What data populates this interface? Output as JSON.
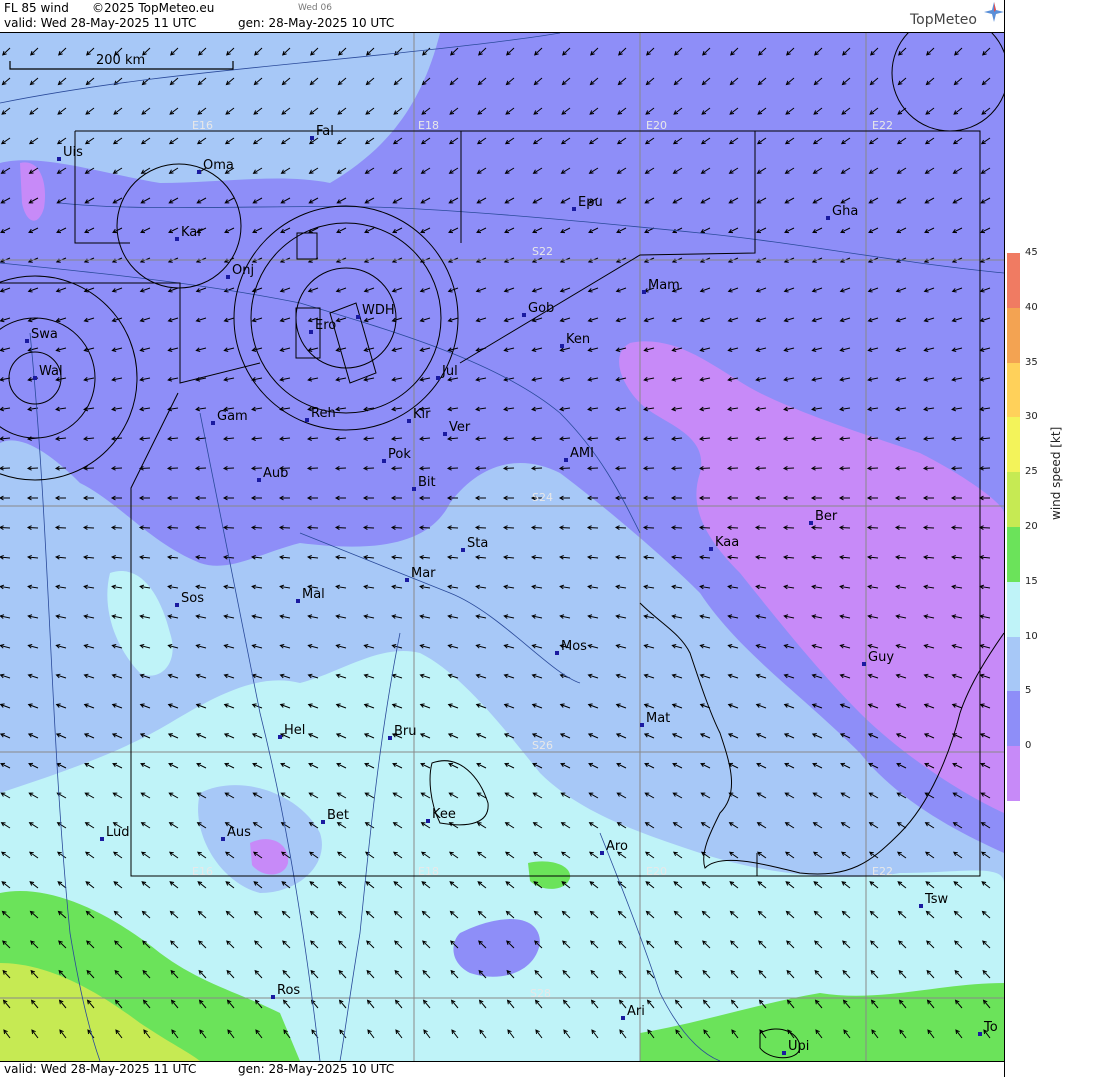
{
  "header": {
    "title": "FL 85 wind",
    "copyright": "©2025 TopMeteo.eu",
    "day": "Wed 06",
    "valid": "valid:  Wed  28-May-2025  11 UTC",
    "gen": "gen: 28-May-2025 10 UTC",
    "logo": "TopMeteo"
  },
  "footer": {
    "valid": "valid:  Wed  28-May-2025  11 UTC",
    "gen": "gen: 28-May-2025 10 UTC"
  },
  "scale_label": "200 km",
  "grid_labels": [
    "E16",
    "E18",
    "E20",
    "E22",
    "S22",
    "S24",
    "S26",
    "S28"
  ],
  "places": [
    "Uis",
    "Oma",
    "Fal",
    "Kar",
    "Onj",
    "Epu",
    "Gha",
    "Swa",
    "Wal",
    "Gob",
    "Mam",
    "Ken",
    "Ero",
    "WDH",
    "Jul",
    "Gam",
    "Reh",
    "Kir",
    "Ver",
    "Pok",
    "AMI",
    "Bit",
    "Aub",
    "Sta",
    "Ber",
    "Kaa",
    "Mar",
    "Sos",
    "Mal",
    "Mos",
    "Guy",
    "Mat",
    "Hel",
    "Bru",
    "Bet",
    "Kee",
    "Lud",
    "Aus",
    "Aro",
    "Tsw",
    "Ros",
    "Ari",
    "To",
    "Upi"
  ],
  "legend": {
    "ticks": [
      "45",
      "40",
      "35",
      "30",
      "25",
      "20",
      "15",
      "10",
      "5",
      "0"
    ],
    "unit": "wind speed [kt]",
    "colors": [
      "#f07b62",
      "#f3a352",
      "#ffd15a",
      "#f3f35a",
      "#c6ea53",
      "#6be35a",
      "#bff3f8",
      "#a7c8f7",
      "#8e8ef8",
      "#c78af8"
    ]
  }
}
